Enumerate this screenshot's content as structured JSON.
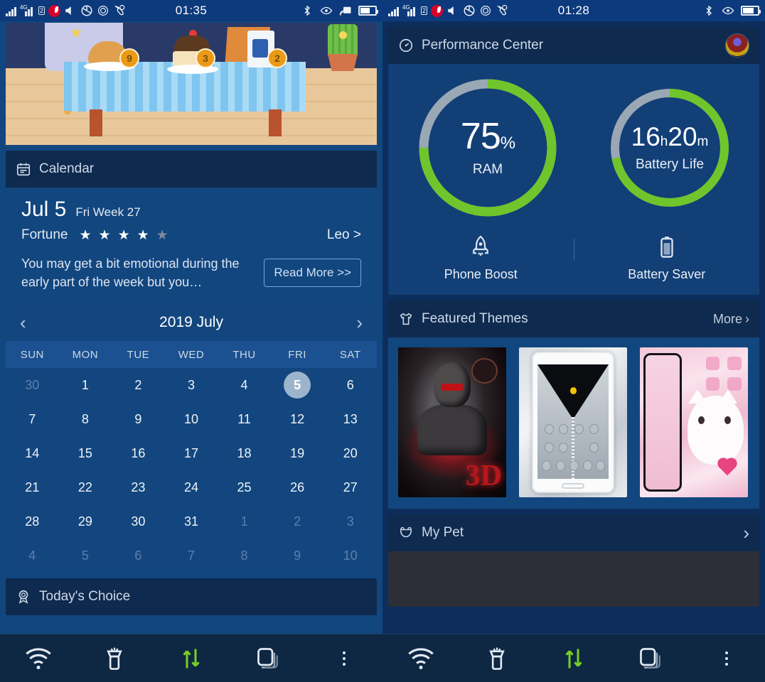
{
  "left": {
    "statusbar": {
      "time": "01:35",
      "left_icons": [
        "signal-icon",
        "signal-4g-icon",
        "sim2-icon",
        "vodafone-icon",
        "volume-mute-icon",
        "screenshot-icon",
        "target-icon",
        "call-icon"
      ],
      "right_icons": [
        "bluetooth-icon",
        "eye-icon",
        "cast-icon",
        "battery-icon"
      ],
      "network_label": "4G",
      "sim_label": "2"
    },
    "game_banner": {
      "items": [
        {
          "name": "bread",
          "count": "9"
        },
        {
          "name": "cake",
          "count": "3"
        },
        {
          "name": "drink",
          "count": "2"
        }
      ]
    },
    "calendar_card": {
      "icon": "calendar-icon",
      "title": "Calendar",
      "date": "Jul 5",
      "weekday_week": "Fri Week 27",
      "fortune_label": "Fortune",
      "stars_filled": 4,
      "stars_total": 5,
      "sign": "Leo >",
      "horoscope": "You may get a bit emotional during the early part of the week but you…",
      "read_more": "Read More >>",
      "month_title": "2019 July",
      "prev_icon": "chevron-left-icon",
      "next_icon": "chevron-right-icon",
      "dow": [
        "SUN",
        "MON",
        "TUE",
        "WED",
        "THU",
        "FRI",
        "SAT"
      ],
      "weeks": [
        [
          {
            "d": "30",
            "dim": true
          },
          {
            "d": "1"
          },
          {
            "d": "2"
          },
          {
            "d": "3"
          },
          {
            "d": "4"
          },
          {
            "d": "5",
            "sel": true
          },
          {
            "d": "6"
          }
        ],
        [
          {
            "d": "7"
          },
          {
            "d": "8"
          },
          {
            "d": "9"
          },
          {
            "d": "10"
          },
          {
            "d": "11"
          },
          {
            "d": "12"
          },
          {
            "d": "13"
          }
        ],
        [
          {
            "d": "14"
          },
          {
            "d": "15"
          },
          {
            "d": "16"
          },
          {
            "d": "17"
          },
          {
            "d": "18"
          },
          {
            "d": "19"
          },
          {
            "d": "20"
          }
        ],
        [
          {
            "d": "21"
          },
          {
            "d": "22"
          },
          {
            "d": "23"
          },
          {
            "d": "24"
          },
          {
            "d": "25"
          },
          {
            "d": "26"
          },
          {
            "d": "27"
          }
        ],
        [
          {
            "d": "28"
          },
          {
            "d": "29"
          },
          {
            "d": "30"
          },
          {
            "d": "31"
          },
          {
            "d": "1",
            "dim": true
          },
          {
            "d": "2",
            "dim": true
          },
          {
            "d": "3",
            "dim": true
          }
        ],
        [
          {
            "d": "4",
            "dim": true
          },
          {
            "d": "5",
            "dim": true
          },
          {
            "d": "6",
            "dim": true
          },
          {
            "d": "7",
            "dim": true
          },
          {
            "d": "8",
            "dim": true
          },
          {
            "d": "9",
            "dim": true
          },
          {
            "d": "10",
            "dim": true
          }
        ]
      ]
    },
    "todays_choice": {
      "icon": "award-icon",
      "title": "Today's Choice"
    }
  },
  "right": {
    "statusbar": {
      "time": "01:28",
      "right_icons": [
        "bluetooth-icon",
        "eye-icon",
        "battery-icon"
      ],
      "network_label": "4G",
      "sim_label": "2"
    },
    "performance": {
      "icon": "speedometer-icon",
      "title": "Performance Center",
      "avatar": "user-avatar",
      "gauges": [
        {
          "value": "75",
          "unit": "%",
          "label": "RAM",
          "percent": 75,
          "color": "#6fc52b",
          "track": "#9aa7b5"
        },
        {
          "value_h": "16",
          "unit_h": "h",
          "value_m": "20",
          "unit_m": "m",
          "label": "Battery Life",
          "percent": 72,
          "color": "#6fc52b",
          "track": "#9aa7b5"
        }
      ],
      "actions": [
        {
          "icon": "rocket-icon",
          "label": "Phone Boost"
        },
        {
          "icon": "battery-saver-icon",
          "label": "Battery Saver"
        }
      ]
    },
    "themes": {
      "icon": "tshirt-icon",
      "title": "Featured Themes",
      "more_label": "More",
      "more_icon": "chevron-right-icon",
      "items": [
        {
          "name": "dark-warrior-3d-theme",
          "badge": "3D"
        },
        {
          "name": "diamond-zipper-theme"
        },
        {
          "name": "pink-kitten-theme"
        }
      ]
    },
    "pet": {
      "icon": "pet-face-icon",
      "title": "My Pet",
      "chevron": "chevron-right-icon"
    }
  },
  "navbar": {
    "buttons": [
      "wifi-icon",
      "flashlight-icon",
      "data-transfer-icon",
      "recent-apps-icon",
      "more-options-icon"
    ]
  }
}
